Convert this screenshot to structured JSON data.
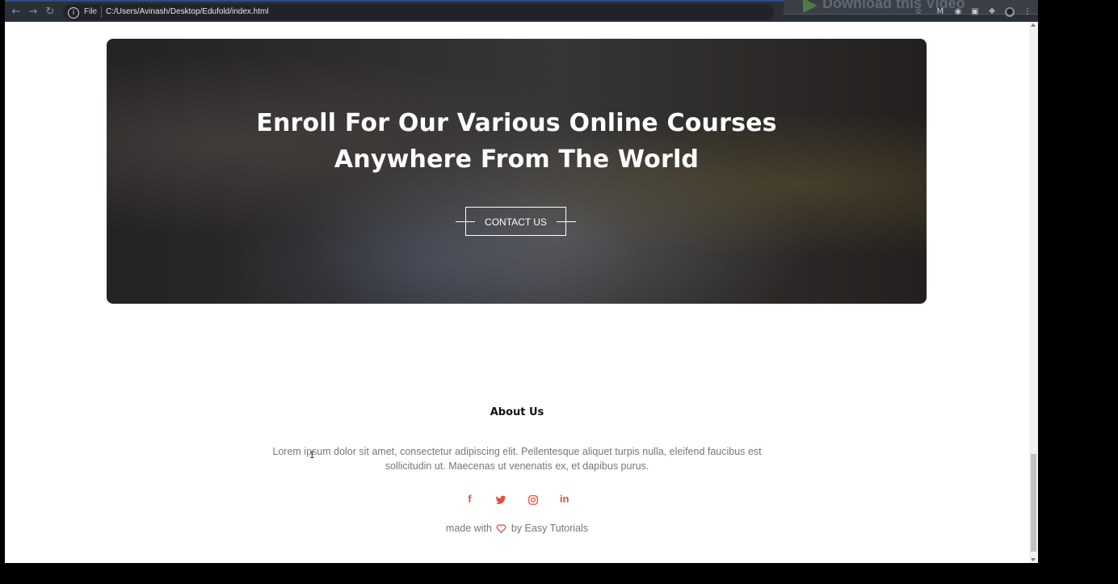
{
  "browser": {
    "scheme": "File",
    "url": "C:/Users/Avinash/Desktop/Edufold/index.html",
    "download_banner": "Download this Video"
  },
  "cta": {
    "heading_line1": "Enroll For Our Various Online Courses",
    "heading_line2": "Anywhere From The World",
    "button": "CONTACT US"
  },
  "about": {
    "title": "About Us",
    "text": "Lorem ipsum dolor sit amet, consectetur adipiscing elit. Pellentesque aliquet turpis nulla, eleifend faucibus est sollicitudin ut. Maecenas ut venenatis ex, et dapibus purus."
  },
  "social": [
    {
      "icon": "facebook-icon",
      "glyph": "f"
    },
    {
      "icon": "twitter-icon",
      "glyph": "twitter"
    },
    {
      "icon": "instagram-icon",
      "glyph": "instagram"
    },
    {
      "icon": "linkedin-icon",
      "glyph": "in"
    }
  ],
  "footer": {
    "made_prefix": "made with",
    "made_suffix": "by Easy Tutorials"
  },
  "colors": {
    "accent": "#e74c3c",
    "chrome_bg": "#2b2f38",
    "text_muted": "#777777"
  }
}
